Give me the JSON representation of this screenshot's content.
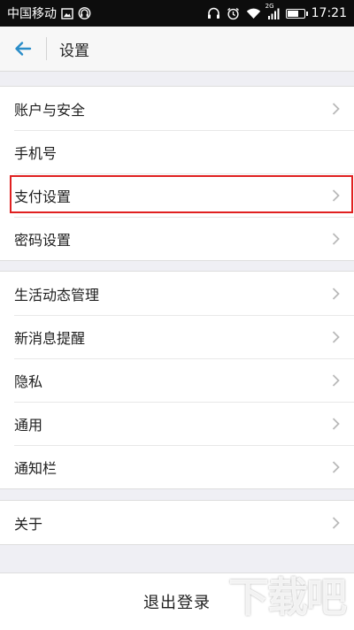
{
  "status_bar": {
    "carrier": "中国移动",
    "network_tag": "2G",
    "time": "17:21",
    "battery_level": 0.75
  },
  "header": {
    "title": "设置"
  },
  "groups": [
    {
      "items": [
        "账户与安全",
        "手机号",
        "支付设置",
        "密码设置"
      ]
    },
    {
      "items": [
        "生活动态管理",
        "新消息提醒",
        "隐私",
        "通用",
        "通知栏"
      ]
    },
    {
      "items": [
        "关于"
      ]
    }
  ],
  "logout": {
    "label": "退出登录"
  },
  "watermark": "下载吧",
  "colors": {
    "accent": "#2a8dc8",
    "highlight": "#e02020",
    "background": "#efeff4"
  }
}
